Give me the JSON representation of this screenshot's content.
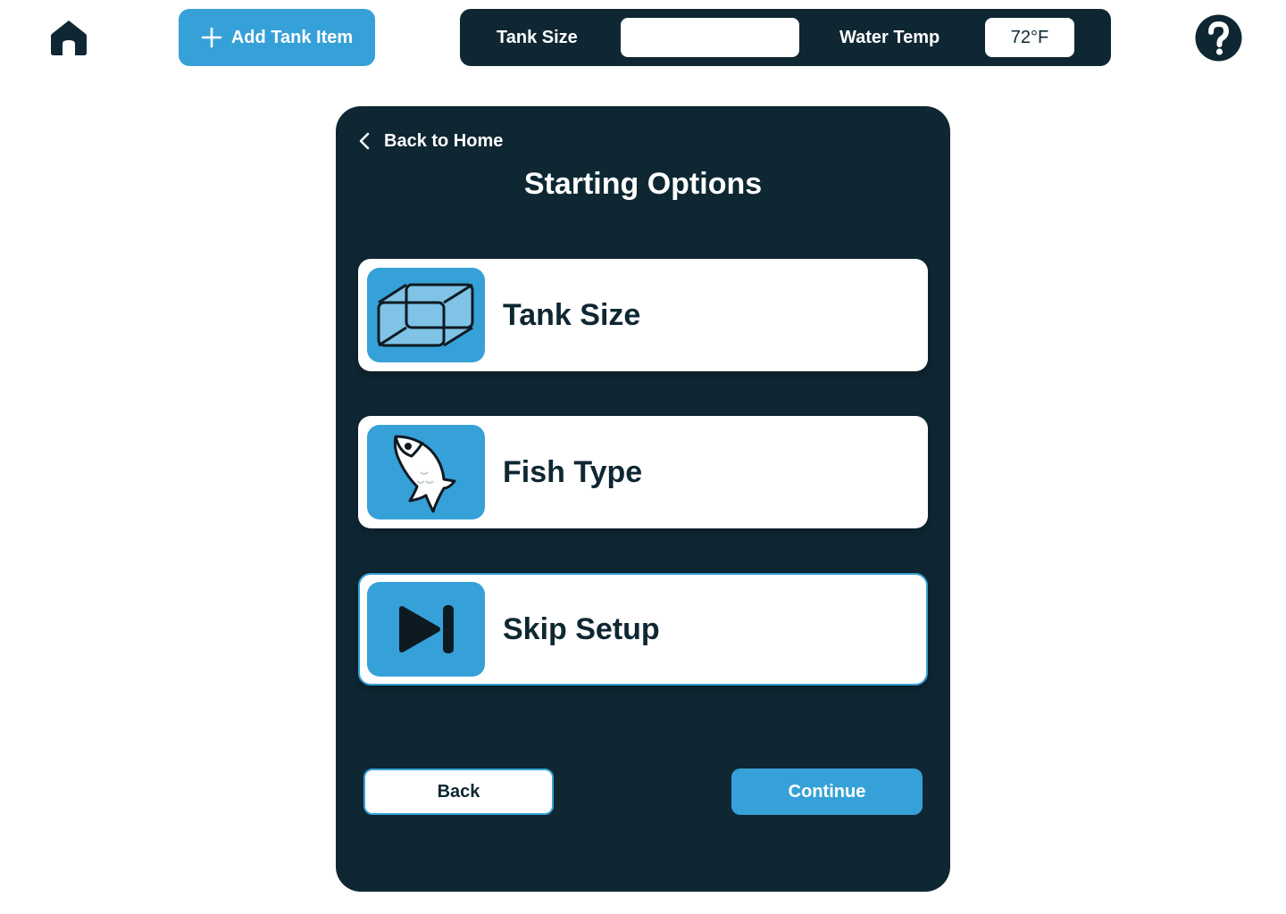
{
  "topbar": {
    "home_icon": "home-icon",
    "add_button_label": "Add Tank Item",
    "add_button_icon": "plus-icon",
    "help_icon": "help-icon",
    "tank_size_label": "Tank Size",
    "tank_size_value": "",
    "water_temp_label": "Water Temp",
    "water_temp_value": "72°F"
  },
  "panel": {
    "back_link": "Back to Home",
    "title": "Starting Options",
    "options": [
      {
        "label": "Tank Size",
        "icon": "tank-cube-icon",
        "selected": false
      },
      {
        "label": "Fish Type",
        "icon": "fish-icon",
        "selected": false
      },
      {
        "label": "Skip Setup",
        "icon": "skip-forward-icon",
        "selected": true
      }
    ],
    "back_button": "Back",
    "continue_button": "Continue"
  },
  "colors": {
    "navy": "#0e2733",
    "accent_blue": "#36a1d8",
    "light_blue": "#7fc3e6",
    "white": "#ffffff"
  }
}
